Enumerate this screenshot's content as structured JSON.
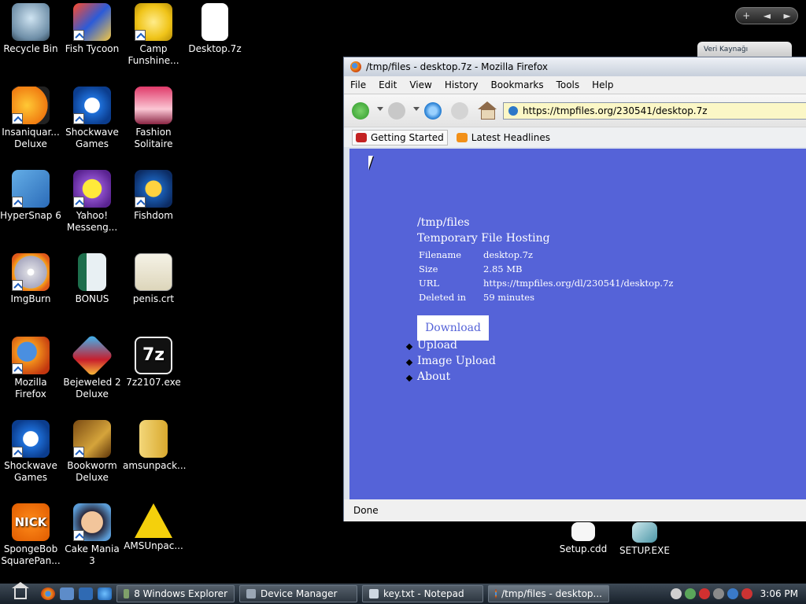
{
  "desktop": {
    "icons": [
      {
        "label": "Recycle Bin",
        "icon": "recycle-bin-icon"
      },
      {
        "label": "Fish Tycoon",
        "icon": "fish-tycoon-icon"
      },
      {
        "label": "Camp Funshine...",
        "icon": "camp-funshine-icon"
      },
      {
        "label": "Desktop.7z",
        "icon": "file-icon"
      },
      {
        "label": "Insaniquar... Deluxe",
        "icon": "insaniquarium-icon"
      },
      {
        "label": "Shockwave Games",
        "icon": "shockwave-icon"
      },
      {
        "label": "Fashion Solitaire",
        "icon": "fashion-solitaire-icon"
      },
      {
        "label": "HyperSnap 6",
        "icon": "hypersnap-icon"
      },
      {
        "label": "Yahoo! Messeng...",
        "icon": "yahoo-messenger-icon"
      },
      {
        "label": "Fishdom",
        "icon": "fishdom-icon"
      },
      {
        "label": "ImgBurn",
        "icon": "imgburn-icon"
      },
      {
        "label": "BONUS",
        "icon": "bonus-icon"
      },
      {
        "label": "penis.crt",
        "icon": "certificate-icon"
      },
      {
        "label": "Mozilla Firefox",
        "icon": "firefox-icon"
      },
      {
        "label": "Bejeweled 2 Deluxe",
        "icon": "bejeweled-icon"
      },
      {
        "label": "7z2107.exe",
        "icon": "7zip-icon"
      },
      {
        "label": "Shockwave Games",
        "icon": "shockwave-icon"
      },
      {
        "label": "Bookworm Deluxe",
        "icon": "bookworm-icon"
      },
      {
        "label": "amsunpack...",
        "icon": "zip-folder-icon"
      },
      {
        "label": "SpongeBob SquarePan...",
        "icon": "nick-icon"
      },
      {
        "label": "Cake Mania 3",
        "icon": "cake-mania-icon"
      },
      {
        "label": "AMSUnpac...",
        "icon": "warning-icon"
      },
      {
        "label": "Setup.cdd",
        "icon": "file-icon"
      },
      {
        "label": "SETUP.EXE",
        "icon": "setup-icon"
      }
    ],
    "gadget": {
      "label": "Veri Kaynağı",
      "controls": [
        "+",
        "◄",
        "►"
      ]
    }
  },
  "browser": {
    "title": "/tmp/files - desktop.7z - Mozilla Firefox",
    "menu": [
      "File",
      "Edit",
      "View",
      "History",
      "Bookmarks",
      "Tools",
      "Help"
    ],
    "url": "https://tmpfiles.org/230541/desktop.7z",
    "bookmarks": [
      "Getting Started",
      "Latest Headlines"
    ],
    "page": {
      "site_title": "/tmp/files",
      "subtitle": "Temporary File Hosting",
      "info": [
        {
          "key": "Filename",
          "value": "desktop.7z"
        },
        {
          "key": "Size",
          "value": "2.85 MB"
        },
        {
          "key": "URL",
          "value": "https://tmpfiles.org/dl/230541/desktop.7z"
        },
        {
          "key": "Deleted in",
          "value": "59 minutes"
        }
      ],
      "download_label": "Download",
      "links": [
        "Upload",
        "Image Upload",
        "About"
      ]
    },
    "status": "Done"
  },
  "taskbar": {
    "tasks": [
      "8 Windows Explorer",
      "Device Manager",
      "key.txt - Notepad",
      "/tmp/files - desktop..."
    ],
    "clock": "3:06 PM"
  },
  "colors": {
    "page_bg": "#5563d8",
    "taskbar": "#1f2a35"
  }
}
